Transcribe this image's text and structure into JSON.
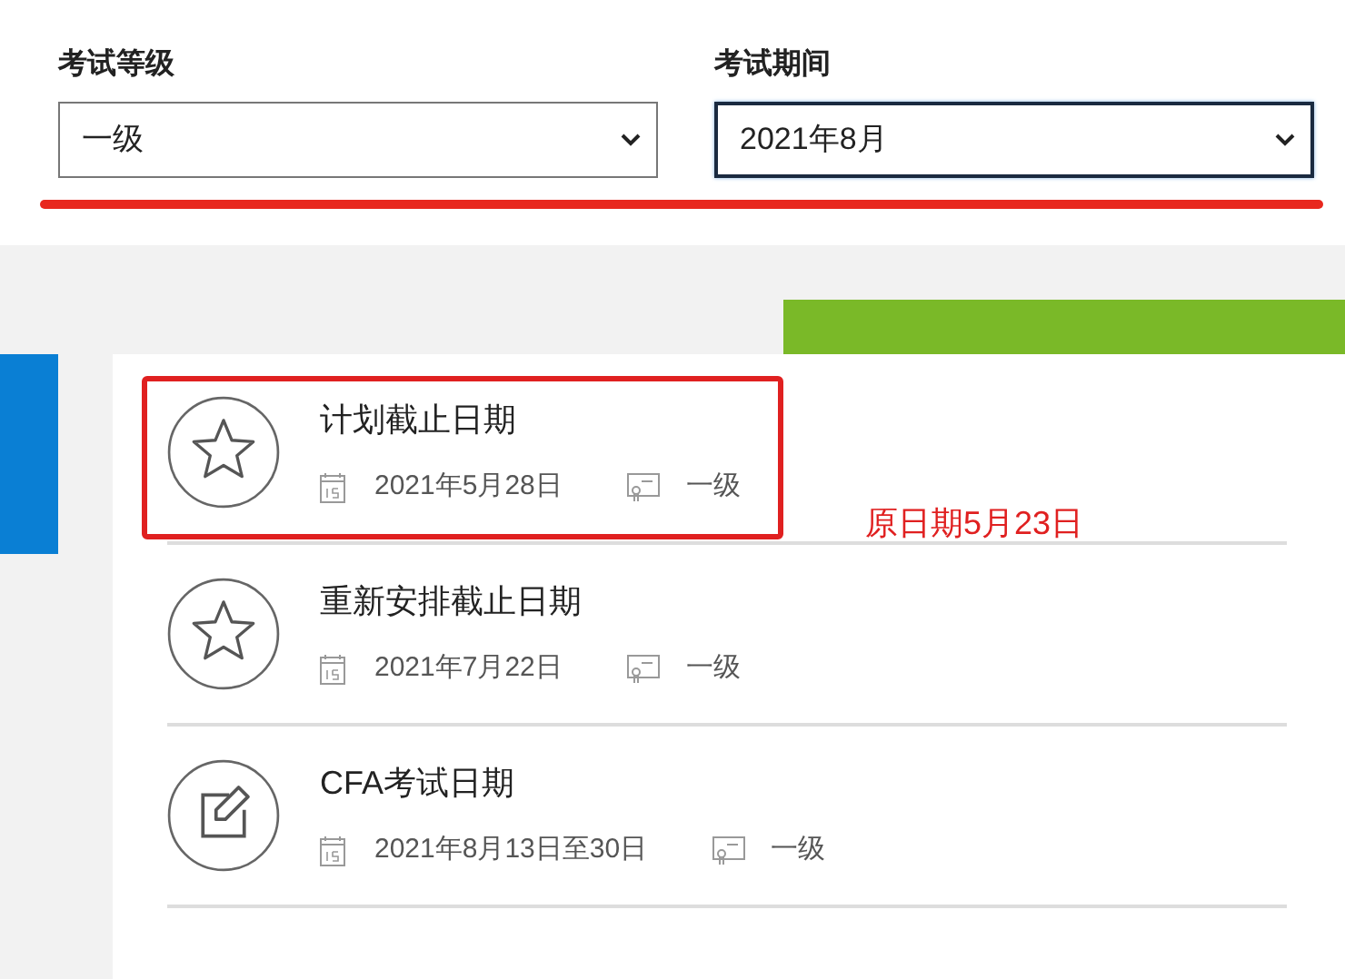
{
  "filters": [
    {
      "label": "考试等级",
      "value": "一级",
      "focused": false
    },
    {
      "label": "考试期间",
      "value": "2021年8月",
      "focused": true
    }
  ],
  "events": [
    {
      "kind": "star",
      "title": "计划截止日期",
      "date": "2021年5月28日",
      "level": "一级",
      "highlighted": true
    },
    {
      "kind": "star",
      "title": "重新安排截止日期",
      "date": "2021年7月22日",
      "level": "一级",
      "highlighted": false
    },
    {
      "kind": "edit",
      "title": "CFA考试日期",
      "date": "2021年8月13日至30日",
      "level": "一级",
      "highlighted": false
    }
  ],
  "annotation": "原日期5月23日"
}
